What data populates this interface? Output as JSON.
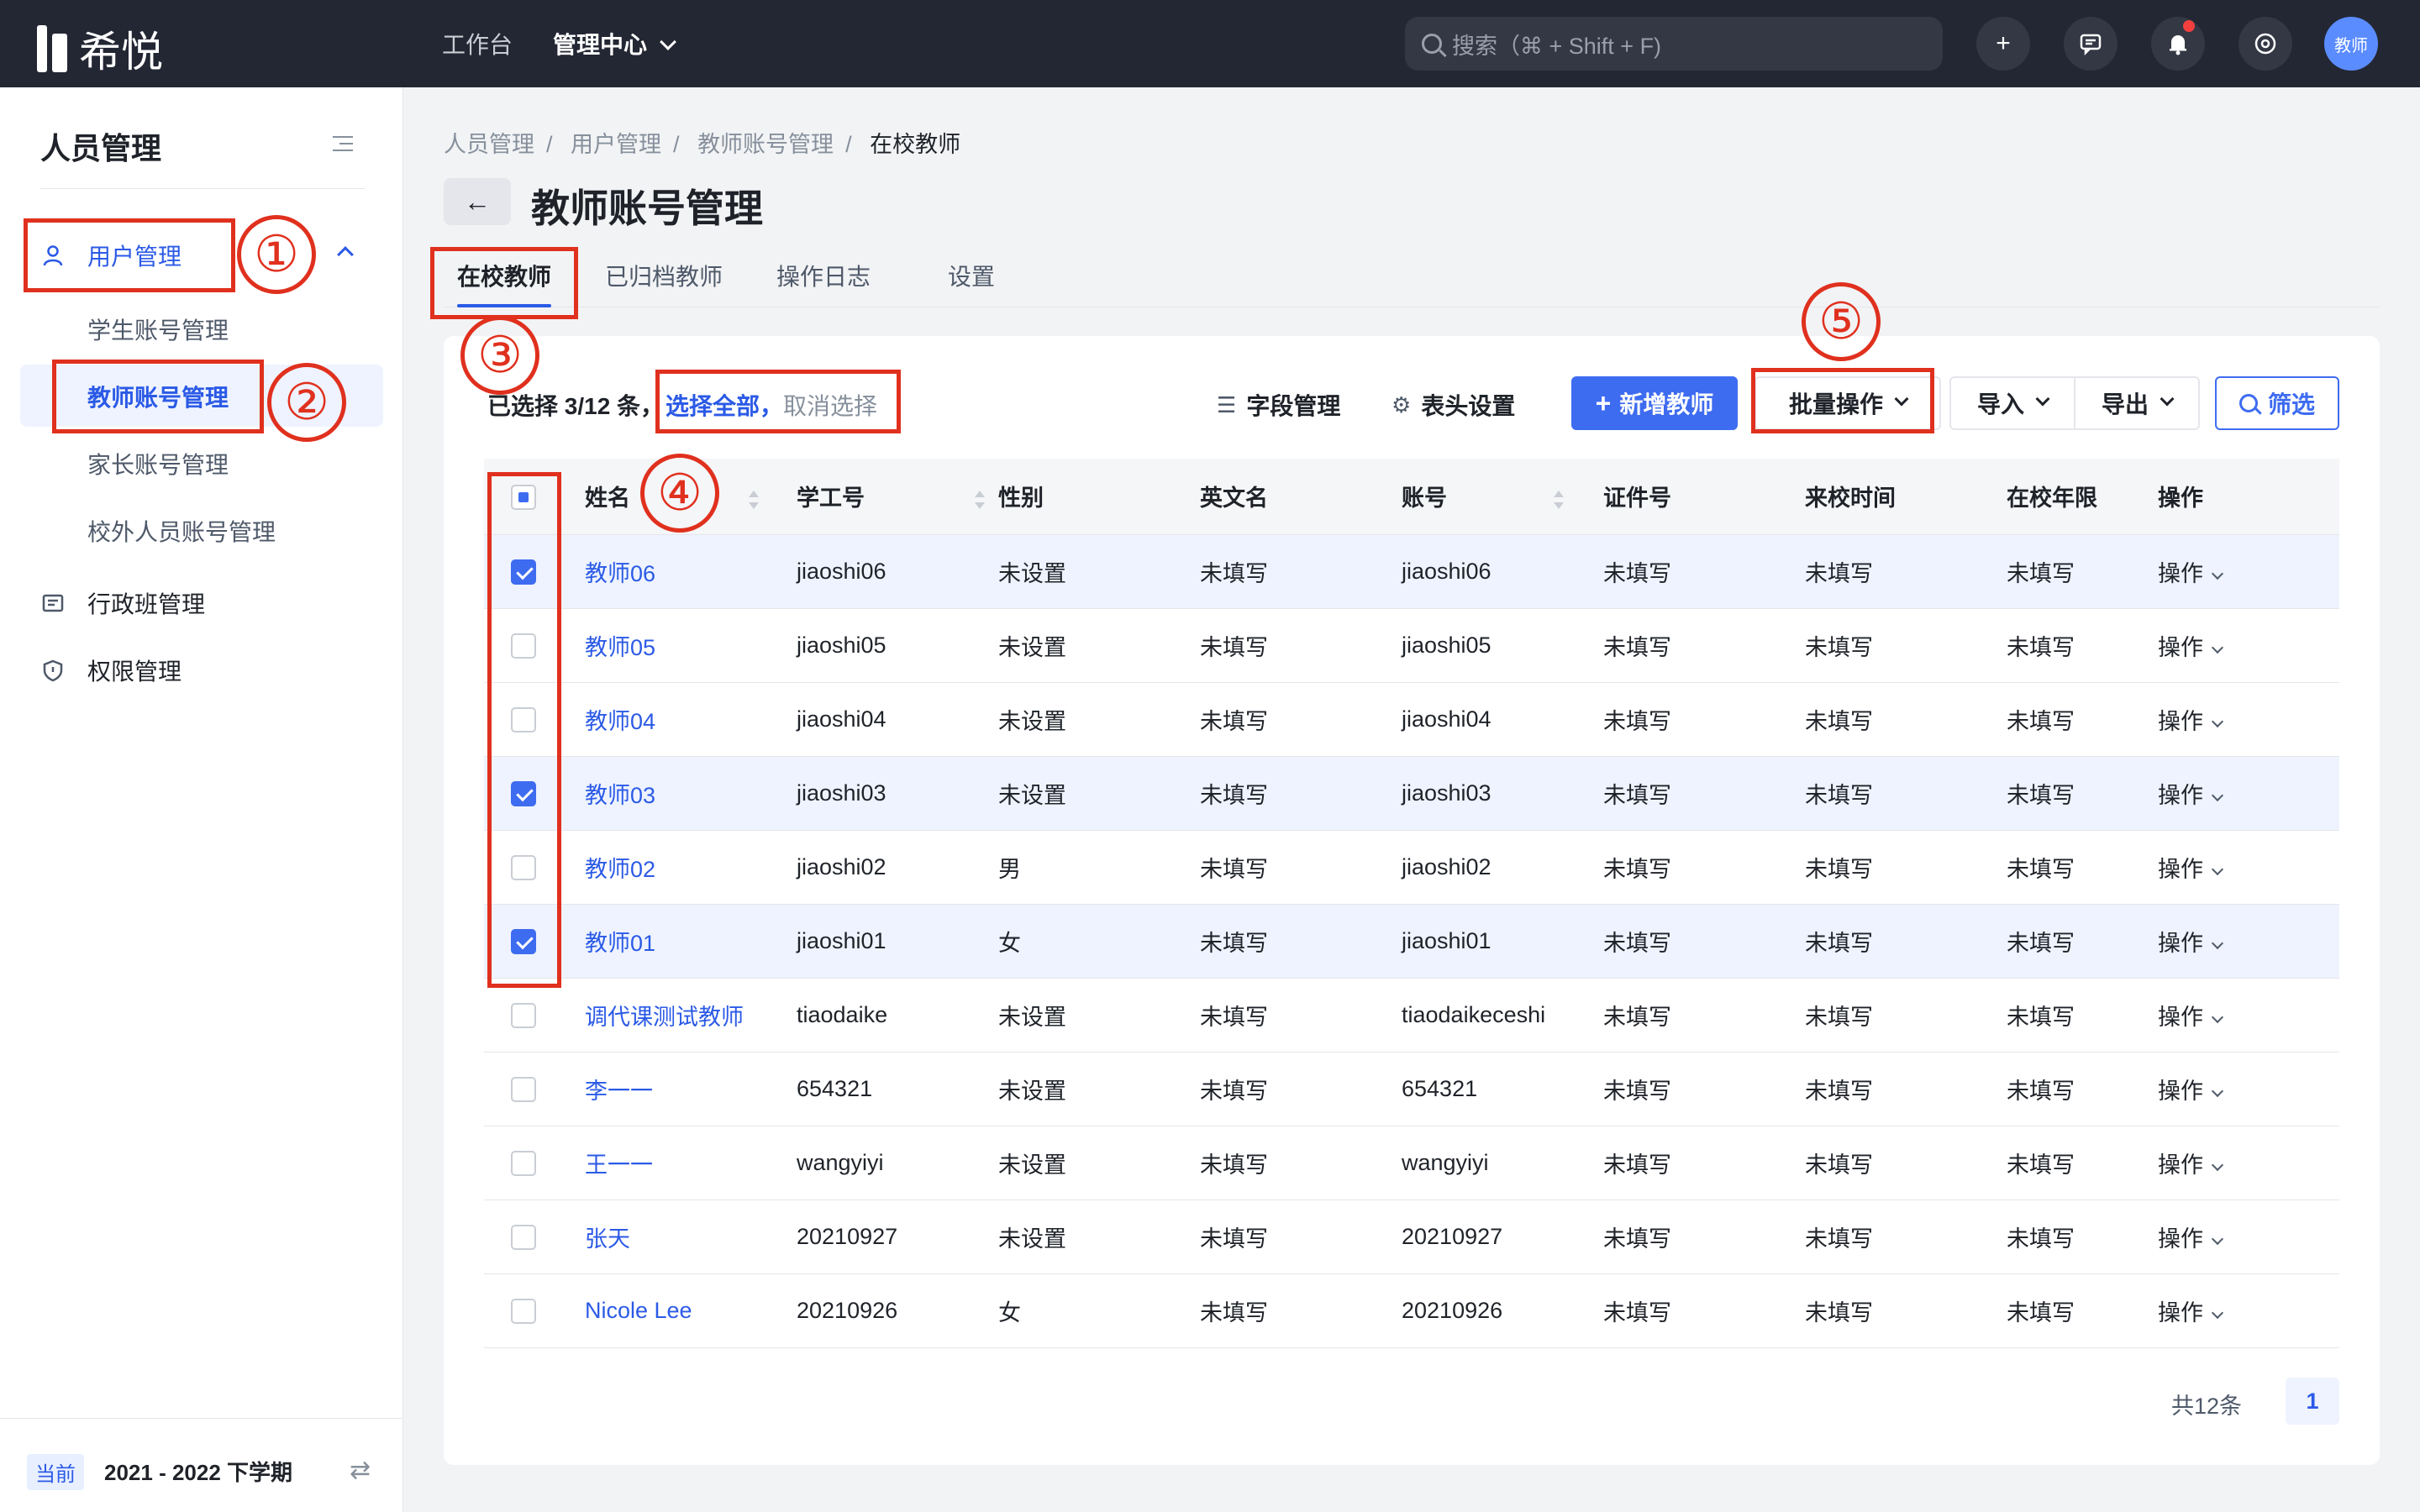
{
  "app": {
    "logo_text": "希悦"
  },
  "topnav": {
    "workbench": "工作台",
    "admin_center": "管理中心",
    "search_placeholder": "搜索（⌘ + Shift + F)",
    "avatar_text": "教师"
  },
  "sidebar": {
    "title": "人员管理",
    "menu": [
      {
        "label": "用户管理",
        "icon": "user-icon"
      },
      {
        "label": "行政班管理",
        "icon": "class-icon"
      },
      {
        "label": "权限管理",
        "icon": "shield-icon"
      }
    ],
    "sub_items": [
      "学生账号管理",
      "教师账号管理",
      "家长账号管理",
      "校外人员账号管理"
    ],
    "term_badge": "当前",
    "term": "2021 - 2022 下学期"
  },
  "breadcrumb": [
    "人员管理",
    "用户管理",
    "教师账号管理",
    "在校教师"
  ],
  "page": {
    "title": "教师账号管理"
  },
  "tabs": [
    "在校教师",
    "已归档教师",
    "操作日志",
    "设置"
  ],
  "toolbar": {
    "selected": "已选择 3/12 条，",
    "select_all": "选择全部，",
    "cancel_select": "取消选择",
    "field_manage": "字段管理",
    "header_settings": "表头设置",
    "add_teacher": "新增教师",
    "batch_ops": "批量操作",
    "import": "导入",
    "export": "导出",
    "filter": "筛选"
  },
  "table": {
    "columns": [
      "姓名",
      "学工号",
      "性别",
      "英文名",
      "账号",
      "证件号",
      "来校时间",
      "在校年限",
      "操作"
    ],
    "rows": [
      {
        "checked": true,
        "cells": [
          "教师06",
          "jiaoshi06",
          "未设置",
          "未填写",
          "jiaoshi06",
          "未填写",
          "未填写",
          "未填写",
          "操作"
        ]
      },
      {
        "checked": false,
        "cells": [
          "教师05",
          "jiaoshi05",
          "未设置",
          "未填写",
          "jiaoshi05",
          "未填写",
          "未填写",
          "未填写",
          "操作"
        ]
      },
      {
        "checked": false,
        "cells": [
          "教师04",
          "jiaoshi04",
          "未设置",
          "未填写",
          "jiaoshi04",
          "未填写",
          "未填写",
          "未填写",
          "操作"
        ]
      },
      {
        "checked": true,
        "cells": [
          "教师03",
          "jiaoshi03",
          "未设置",
          "未填写",
          "jiaoshi03",
          "未填写",
          "未填写",
          "未填写",
          "操作"
        ]
      },
      {
        "checked": false,
        "cells": [
          "教师02",
          "jiaoshi02",
          "男",
          "未填写",
          "jiaoshi02",
          "未填写",
          "未填写",
          "未填写",
          "操作"
        ]
      },
      {
        "checked": true,
        "cells": [
          "教师01",
          "jiaoshi01",
          "女",
          "未填写",
          "jiaoshi01",
          "未填写",
          "未填写",
          "未填写",
          "操作"
        ]
      },
      {
        "checked": false,
        "cells": [
          "调代课测试教师",
          "tiaodaike",
          "未设置",
          "未填写",
          "tiaodaikeceshi",
          "未填写",
          "未填写",
          "未填写",
          "操作"
        ]
      },
      {
        "checked": false,
        "cells": [
          "李一一",
          "654321",
          "未设置",
          "未填写",
          "654321",
          "未填写",
          "未填写",
          "未填写",
          "操作"
        ]
      },
      {
        "checked": false,
        "cells": [
          "王一一",
          "wangyiyi",
          "未设置",
          "未填写",
          "wangyiyi",
          "未填写",
          "未填写",
          "未填写",
          "操作"
        ]
      },
      {
        "checked": false,
        "cells": [
          "张天",
          "20210927",
          "未设置",
          "未填写",
          "20210927",
          "未填写",
          "未填写",
          "未填写",
          "操作"
        ]
      },
      {
        "checked": false,
        "cells": [
          "Nicole Lee",
          "20210926",
          "女",
          "未填写",
          "20210926",
          "未填写",
          "未填写",
          "未填写",
          "操作"
        ]
      }
    ]
  },
  "pager": {
    "total": "共12条",
    "page": "1"
  },
  "annotations": [
    "①",
    "②",
    "③",
    "④",
    "⑤"
  ],
  "colors": {
    "accent": "#3e6cf0",
    "annotation": "#e0301e",
    "topbar": "#232733"
  }
}
